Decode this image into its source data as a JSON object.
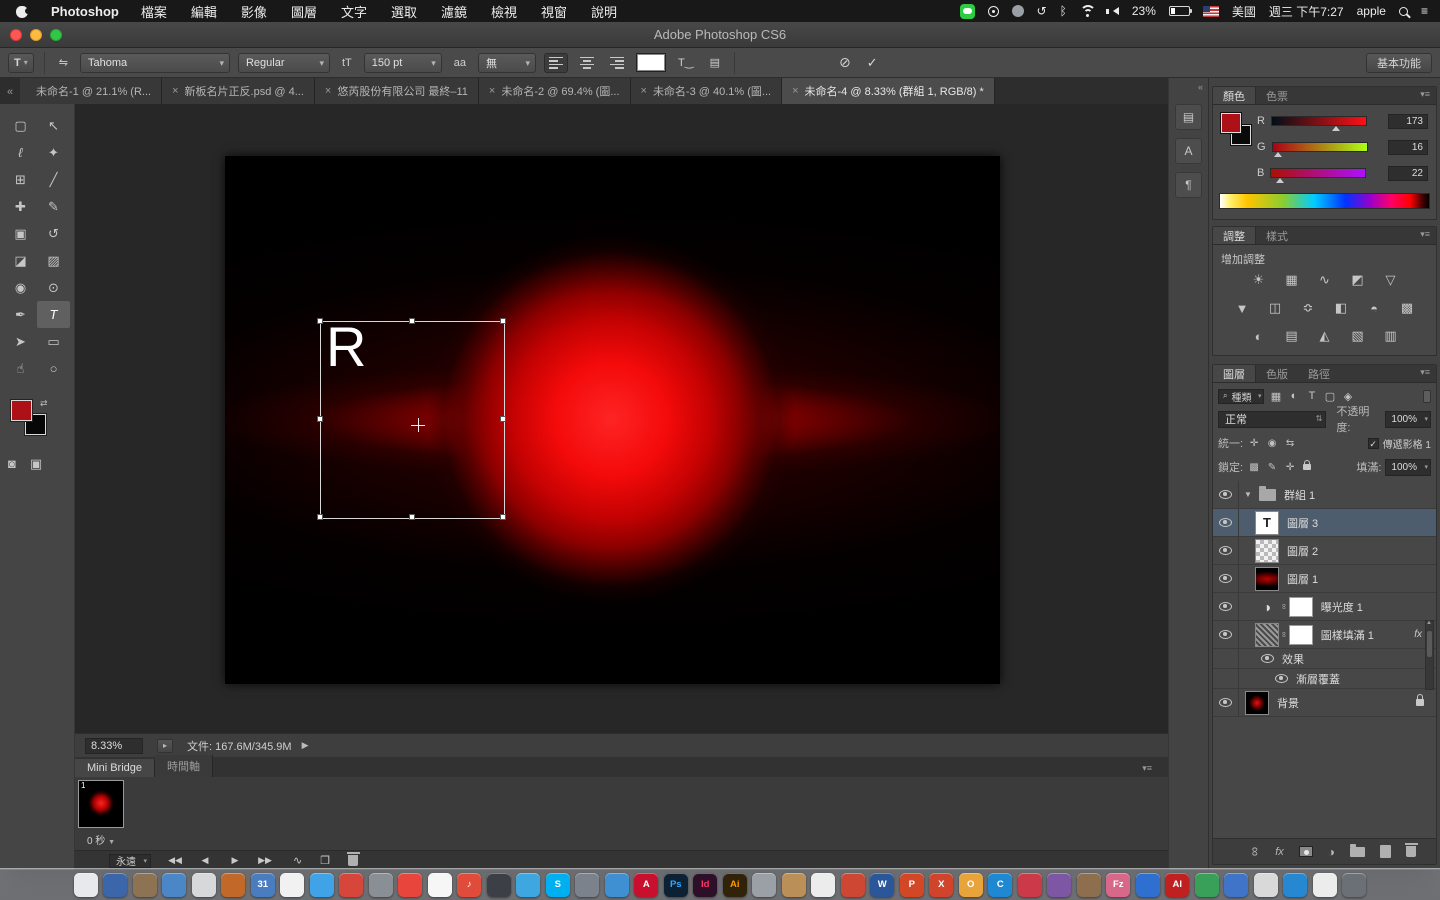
{
  "menubar": {
    "app_name": "Photoshop",
    "menus": [
      {
        "label": "檔案"
      },
      {
        "label": "編輯"
      },
      {
        "label": "影像"
      },
      {
        "label": "圖層"
      },
      {
        "label": "文字"
      },
      {
        "label": "選取"
      },
      {
        "label": "濾鏡"
      },
      {
        "label": "檢視"
      },
      {
        "label": "視窗"
      },
      {
        "label": "說明"
      }
    ],
    "icons": {
      "clock": "↺",
      "bluetooth": "ᛒ",
      "notification": "≡"
    },
    "status_right": {
      "battery_pct": "23%",
      "input_lang": "美國",
      "clock": "週三 下午7:27",
      "username": "apple"
    }
  },
  "window_title": "Adobe Photoshop CS6",
  "icons": {
    "panel_menu": "▾≡",
    "chev_left": "«",
    "chev_right": "»",
    "check": "✓",
    "cancel": "⊘",
    "play": "▶",
    "expand": "▸"
  },
  "options_bar": {
    "tool_preset": "T",
    "orientation_glyph": "⇋",
    "font_family": "Tahoma",
    "font_style": "Regular",
    "size_icon": "tT",
    "font_size": "150 pt",
    "aa_icon": "aa",
    "anti_alias": "無",
    "warp_glyph": "T‿",
    "panels_glyph": "▤",
    "workspace": "基本功能"
  },
  "tabs": [
    {
      "label": "未命名-1 @ 21.1% (R...",
      "close": ""
    },
    {
      "label": "新板名片正反.psd @ 4...",
      "close": "×"
    },
    {
      "label": "悠芮股份有限公司 最終–11",
      "close": "×"
    },
    {
      "label": "未命名-2 @ 69.4% (圖...",
      "close": "×"
    },
    {
      "label": "未命名-3 @ 40.1% (圖...",
      "close": "×"
    },
    {
      "label": "未命名-4 @ 8.33% (群組 1, RGB/8) *",
      "close": "×",
      "cls": "active"
    }
  ],
  "tools": [
    {
      "g": "▢",
      "n": "rectangular-marquee-tool"
    },
    {
      "g": "↖",
      "n": "move-tool"
    },
    {
      "g": "ℓ",
      "n": "lasso-tool"
    },
    {
      "g": "✦",
      "n": "quick-selection-tool"
    },
    {
      "g": "⊞",
      "n": "crop-tool"
    },
    {
      "g": "╱",
      "n": "eyedropper-tool"
    },
    {
      "g": "✚",
      "n": "healing-brush-tool"
    },
    {
      "g": "✎",
      "n": "brush-tool"
    },
    {
      "g": "▣",
      "n": "clone-stamp-tool"
    },
    {
      "g": "↺",
      "n": "history-brush-tool"
    },
    {
      "g": "◪",
      "n": "eraser-tool"
    },
    {
      "g": "▨",
      "n": "gradient-tool"
    },
    {
      "g": "◉",
      "n": "blur-tool"
    },
    {
      "g": "⊙",
      "n": "dodge-tool"
    },
    {
      "g": "✒",
      "n": "pen-tool"
    },
    {
      "g": "T",
      "n": "type-tool",
      "cls": "active"
    },
    {
      "g": "➤",
      "n": "path-selection-tool"
    },
    {
      "g": "▭",
      "n": "rectangle-tool"
    },
    {
      "g": "☝",
      "n": "hand-tool"
    },
    {
      "g": "○",
      "n": "zoom-tool"
    }
  ],
  "toolbar_bottom": [
    {
      "g": "◙",
      "n": "quick-mask-button"
    },
    {
      "g": "▣",
      "n": "screen-mode-button"
    }
  ],
  "canvas": {
    "text_layer": "R"
  },
  "doc_status": {
    "zoom": "8.33%",
    "info": "文件: 167.6M/345.9M"
  },
  "bottom_tabs": [
    {
      "label": "Mini Bridge",
      "cls": "active"
    },
    {
      "label": "時間軸"
    }
  ],
  "timeline": {
    "frame_no": "1",
    "delay": "0 秒",
    "delay_caret": "▼",
    "loop": "永遠",
    "buttons": [
      {
        "g": "◀◀",
        "n": "first-frame-button"
      },
      {
        "g": "◀",
        "n": "previous-frame-button"
      },
      {
        "g": "▶",
        "n": "play-button"
      },
      {
        "g": "▶▶",
        "n": "next-frame-button"
      }
    ],
    "tween_glyph": "∿",
    "dup_glyph": "❐"
  },
  "color_panel": {
    "tabs": [
      {
        "label": "顏色",
        "cls": "active"
      },
      {
        "label": "色票"
      }
    ],
    "channels": [
      {
        "label": "R",
        "value": "173",
        "cls": "ch-r",
        "pos": "68%"
      },
      {
        "label": "G",
        "value": "16",
        "cls": "ch-g",
        "pos": "6%"
      },
      {
        "label": "B",
        "value": "22",
        "cls": "ch-b",
        "pos": "9%"
      }
    ]
  },
  "adjust_panel": {
    "tabs": [
      {
        "label": "調整",
        "cls": "active"
      },
      {
        "label": "樣式"
      }
    ],
    "title": "增加調整",
    "row1": [
      {
        "g": "☀"
      },
      {
        "g": "▦"
      },
      {
        "g": "∿"
      },
      {
        "g": "◩"
      },
      {
        "g": "▽"
      }
    ],
    "row2": [
      {
        "g": "▼"
      },
      {
        "g": "◫"
      },
      {
        "g": "≎"
      },
      {
        "g": "◧"
      },
      {
        "g": "◓"
      },
      {
        "g": "▩"
      }
    ],
    "row3": [
      {
        "g": "◐"
      },
      {
        "g": "▤"
      },
      {
        "g": "◭"
      },
      {
        "g": "▧"
      },
      {
        "g": "▥"
      }
    ]
  },
  "layers_panel": {
    "tabs": [
      {
        "label": "圖層",
        "cls": "active"
      },
      {
        "label": "色版"
      },
      {
        "label": "路徑"
      }
    ],
    "filter_label": "種類",
    "filter_icons": [
      {
        "g": "▦"
      },
      {
        "g": "◐"
      },
      {
        "g": "T"
      },
      {
        "g": "▢"
      },
      {
        "g": "◈"
      }
    ],
    "blend_mode": "正常",
    "opacity_label": "不透明度:",
    "opacity": "100%",
    "unify_label": "統一:",
    "unify_icons": [
      {
        "g": "✛"
      },
      {
        "g": "◉"
      },
      {
        "g": "⇆"
      }
    ],
    "propagate_label": "傳遞影格 1",
    "lock_label": "鎖定:",
    "lock_icons": [
      {
        "g": "▩"
      },
      {
        "g": "✎"
      },
      {
        "g": "✛"
      }
    ],
    "fill_label": "填滿:",
    "fill": "100%",
    "fx_label": "fx",
    "rows": [
      {
        "name": "群組 1",
        "cls": "row-group",
        "n": "layer-row-group-1"
      },
      {
        "name": "圖層 3",
        "cls": "row-text selected",
        "n": "layer-row-layer-3"
      },
      {
        "name": "圖層 2",
        "cls": "row-checker",
        "n": "layer-row-layer-2"
      },
      {
        "name": "圖層 1",
        "cls": "row-red",
        "n": "layer-row-layer-1"
      },
      {
        "name": "曝光度 1",
        "cls": "row-exposure",
        "n": "layer-row-exposure-1"
      },
      {
        "name": "圖樣填滿 1",
        "cls": "row-pattern",
        "n": "layer-row-pattern-fill-1"
      },
      {
        "name": "效果",
        "cls": "row-effects",
        "n": "layer-row-effects"
      },
      {
        "name": "漸層覆蓋",
        "cls": "row-effect-item",
        "n": "layer-row-gradient-overlay"
      },
      {
        "name": "背景",
        "cls": "row-background",
        "n": "layer-row-background"
      }
    ]
  },
  "side_strip": [
    {
      "g": "▤",
      "n": "histogram-panel-button"
    },
    {
      "g": "A",
      "n": "character-panel-button"
    },
    {
      "g": "¶",
      "n": "paragraph-panel-button"
    }
  ],
  "colors": {
    "foreground": "#ad1016"
  },
  "dock": {
    "items": [
      {
        "c": "#e7e9ec"
      },
      {
        "c": "#3b66a9"
      },
      {
        "c": "#8d7253"
      },
      {
        "c": "#4b87c6"
      },
      {
        "c": "#d6d8da"
      },
      {
        "c": "#c2692a"
      },
      {
        "c": "#4a7cc0",
        "t": "31"
      },
      {
        "c": "#f1f1f1"
      },
      {
        "c": "#40a3e8"
      },
      {
        "c": "#d7463b"
      },
      {
        "c": "#8a8f95"
      },
      {
        "c": "#e8453c"
      },
      {
        "c": "#f6f6f6"
      },
      {
        "c": "#e04b3a",
        "t": "♪"
      },
      {
        "c": "#3c4046"
      },
      {
        "c": "#3fa7e0"
      },
      {
        "c": "#00aff0",
        "t": "S"
      },
      {
        "c": "#7b828b"
      },
      {
        "c": "#3e90d2"
      },
      {
        "c": "#c8102e",
        "t": "A"
      },
      {
        "c": "#0d2134",
        "t": "Ps",
        "fc": "#31a8ff"
      },
      {
        "c": "#2e0f29",
        "t": "Id",
        "fc": "#ff3366"
      },
      {
        "c": "#31230a",
        "t": "Ai",
        "fc": "#ff9a00"
      },
      {
        "c": "#9aa0a6"
      },
      {
        "c": "#bb9058"
      },
      {
        "c": "#ececec"
      },
      {
        "c": "#cd4733"
      },
      {
        "c": "#2b579a",
        "t": "W"
      },
      {
        "c": "#d24726",
        "t": "P"
      },
      {
        "c": "#d0442c",
        "t": "X"
      },
      {
        "c": "#e8a33b",
        "t": "O"
      },
      {
        "c": "#1e88d2",
        "t": "C"
      },
      {
        "c": "#cc3a4a"
      },
      {
        "c": "#7e57a4"
      },
      {
        "c": "#8d6e4e"
      },
      {
        "c": "#d8688a",
        "t": "Fz"
      },
      {
        "c": "#2f6fd0"
      },
      {
        "c": "#c02020",
        "t": "Al"
      },
      {
        "c": "#39a05a"
      },
      {
        "c": "#3f74c9"
      },
      {
        "c": "#d9d9d9"
      },
      {
        "c": "#2588d0"
      },
      {
        "c": "#ececec"
      },
      {
        "c": "#6b7076"
      }
    ]
  }
}
